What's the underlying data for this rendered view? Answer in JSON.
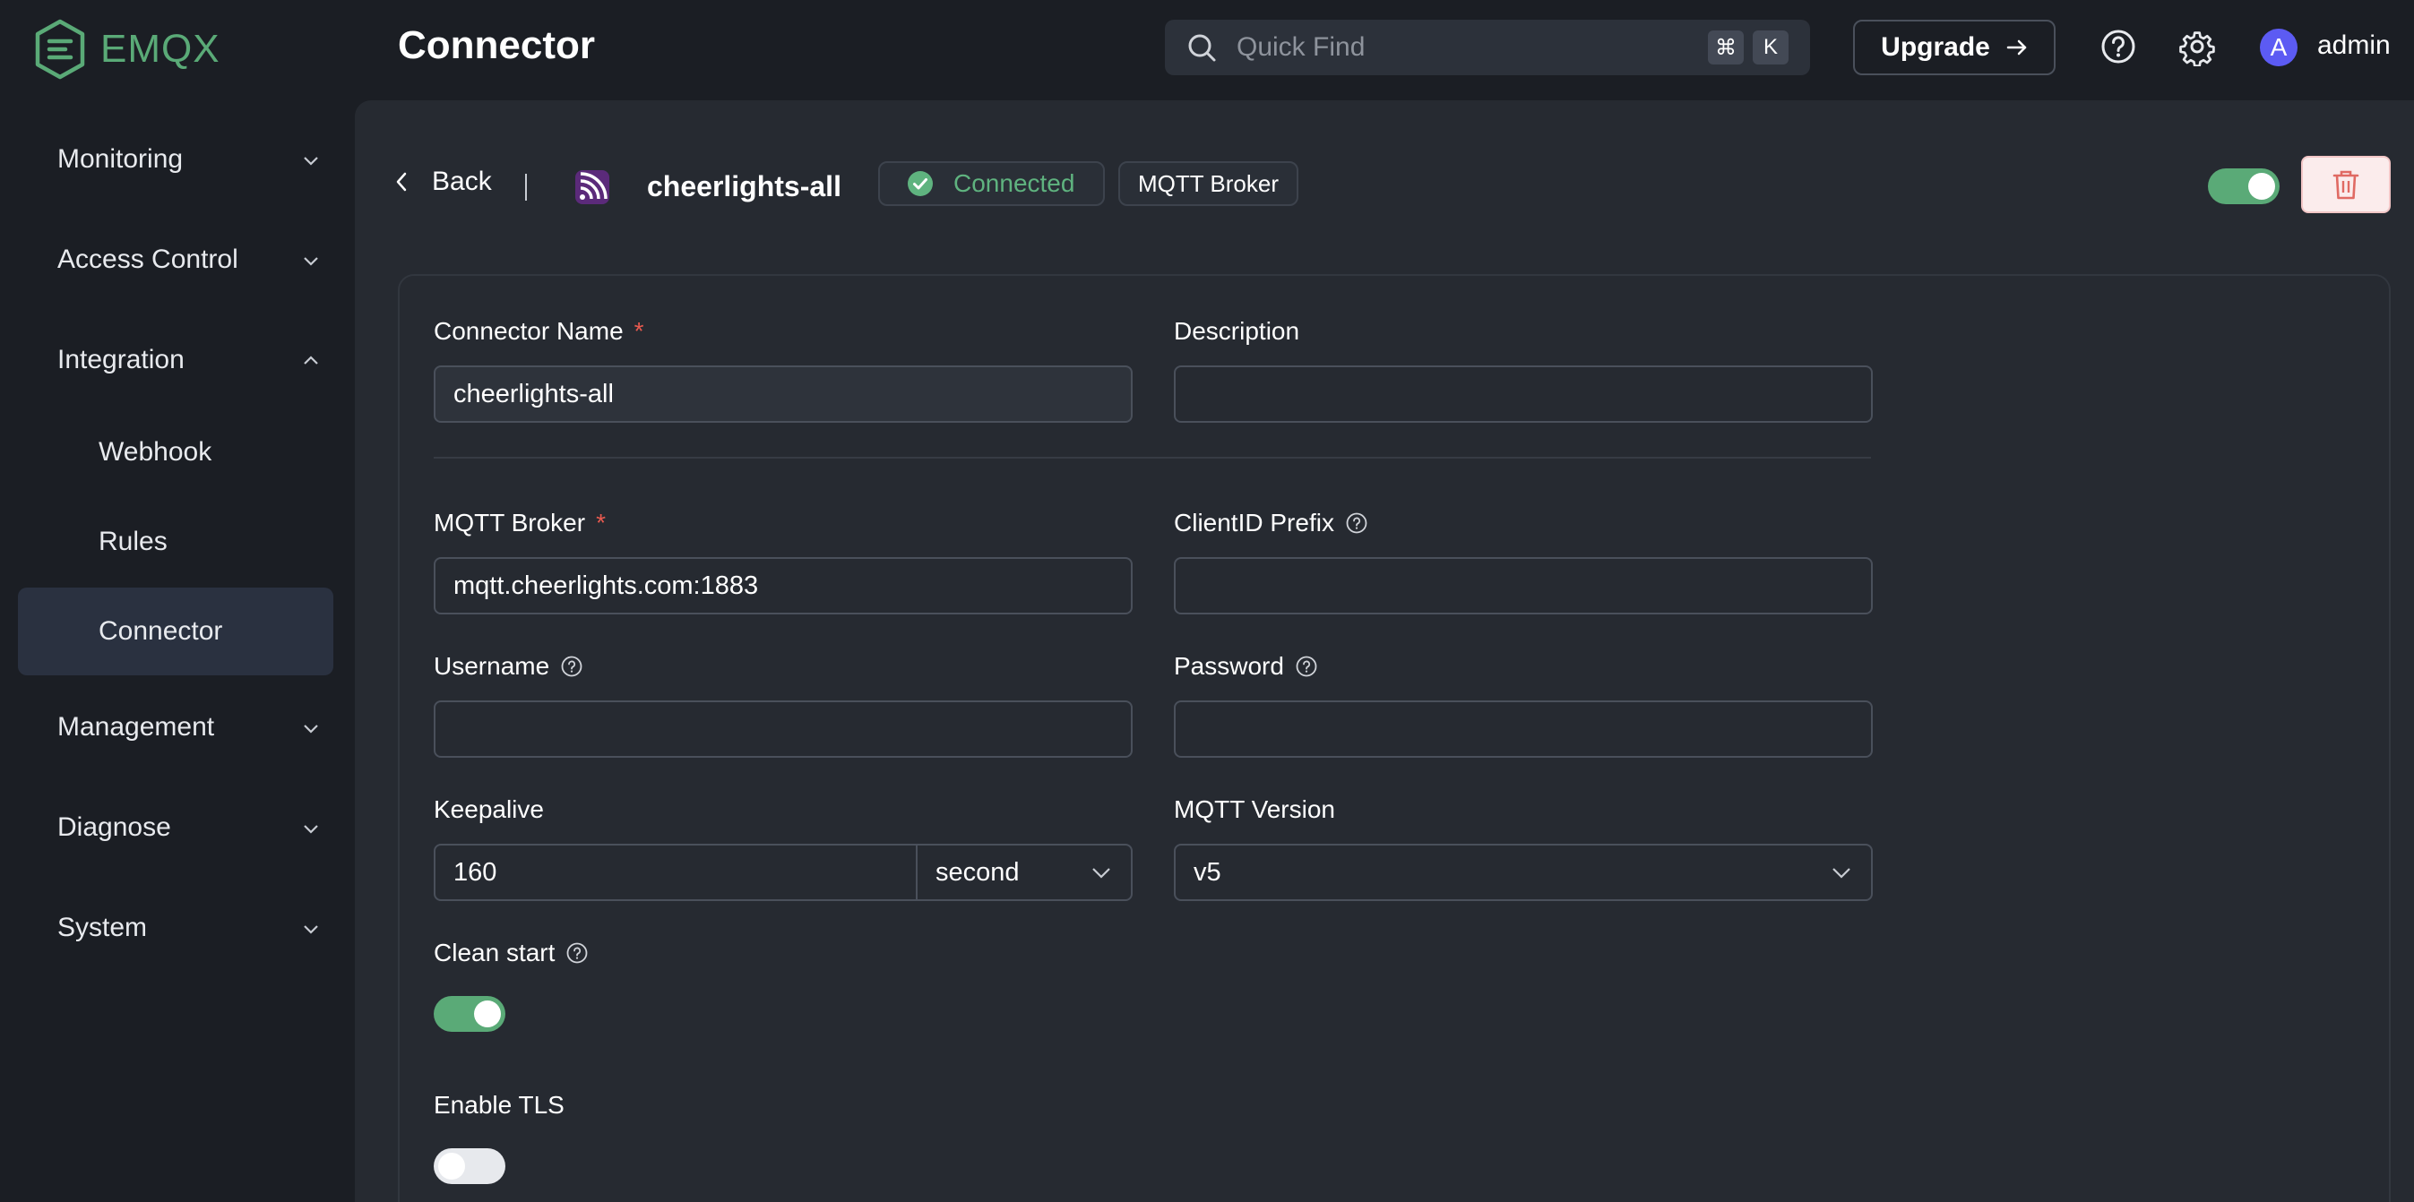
{
  "app": {
    "logo_text": "EMQX",
    "page_title": "Connector"
  },
  "search": {
    "placeholder": "Quick Find",
    "shortcut_cmd": "⌘",
    "shortcut_key": "K"
  },
  "topbar": {
    "upgrade_label": "Upgrade",
    "username": "admin",
    "avatar_letter": "A"
  },
  "sidebar": {
    "items": [
      {
        "label": "Monitoring",
        "expanded": false
      },
      {
        "label": "Access Control",
        "expanded": false
      },
      {
        "label": "Integration",
        "expanded": true
      },
      {
        "label": "Management",
        "expanded": false
      },
      {
        "label": "Diagnose",
        "expanded": false
      },
      {
        "label": "System",
        "expanded": false
      }
    ],
    "integration_children": [
      {
        "label": "Webhook"
      },
      {
        "label": "Rules"
      },
      {
        "label": "Connector",
        "active": true
      }
    ]
  },
  "header": {
    "back_label": "Back",
    "connector_name": "cheerlights-all",
    "status": "Connected",
    "type": "MQTT Broker",
    "enabled": true
  },
  "form": {
    "connector_name": {
      "label": "Connector Name",
      "value": "cheerlights-all",
      "required": "*"
    },
    "description": {
      "label": "Description",
      "value": ""
    },
    "mqtt_broker": {
      "label": "MQTT Broker",
      "value": "mqtt.cheerlights.com:1883",
      "required": "*"
    },
    "clientid_prefix": {
      "label": "ClientID Prefix",
      "value": ""
    },
    "username": {
      "label": "Username",
      "value": ""
    },
    "password": {
      "label": "Password",
      "value": ""
    },
    "keepalive": {
      "label": "Keepalive",
      "value": "160",
      "unit": "second"
    },
    "mqtt_version": {
      "label": "MQTT Version",
      "value": "v5"
    },
    "clean_start": {
      "label": "Clean start",
      "enabled": true
    },
    "enable_tls": {
      "label": "Enable TLS",
      "enabled": false
    }
  },
  "colors": {
    "accent": "#5aaa77",
    "danger": "#e85a4f",
    "background": "#1b1e24",
    "panel": "#262a31"
  }
}
